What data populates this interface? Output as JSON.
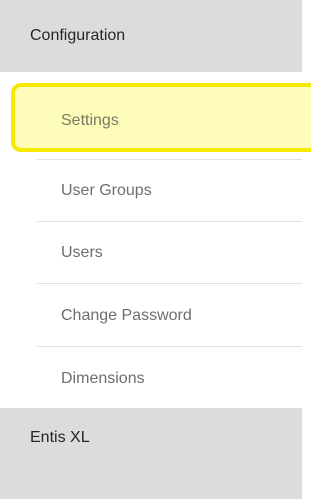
{
  "sections": {
    "configuration": {
      "label": "Configuration"
    },
    "entis": {
      "label": "Entis XL"
    }
  },
  "menu": {
    "items": [
      {
        "label": "Settings",
        "active": true
      },
      {
        "label": "User Groups"
      },
      {
        "label": "Users"
      },
      {
        "label": "Change Password"
      },
      {
        "label": "Dimensions"
      }
    ]
  },
  "colors": {
    "header_bg": "#dcdcdc",
    "highlight_fill": "#fdfcb8",
    "highlight_border": "#f5ea00",
    "item_text": "#6e6e6e",
    "divider": "#e2e2e2"
  }
}
